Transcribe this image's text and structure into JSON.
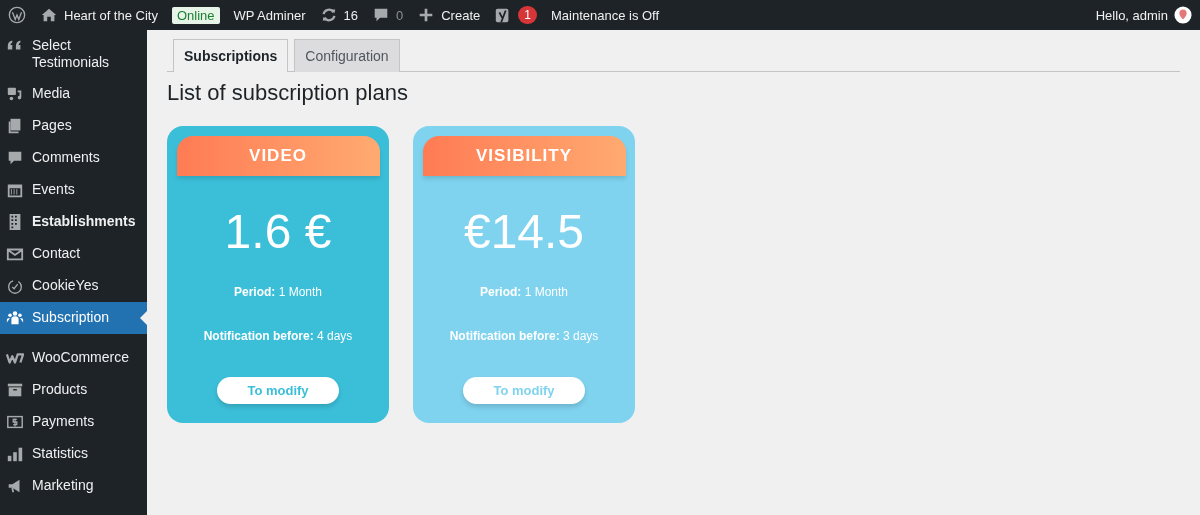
{
  "admin_bar": {
    "site_name": "Heart of the City",
    "status_badge": "Online",
    "adminer": "WP Adminer",
    "updates": "16",
    "comments": "0",
    "create": "Create",
    "seo_count": "1",
    "maintenance": "Maintenance is Off",
    "greeting": "Hello, admin"
  },
  "sidebar": {
    "items": [
      {
        "label": "Select Testimonials",
        "selected": false,
        "bold": false
      },
      {
        "label": "Media",
        "selected": false,
        "bold": false
      },
      {
        "label": "Pages",
        "selected": false,
        "bold": false
      },
      {
        "label": "Comments",
        "selected": false,
        "bold": false
      },
      {
        "label": "Events",
        "selected": false,
        "bold": false
      },
      {
        "label": "Establishments",
        "selected": false,
        "bold": true
      },
      {
        "label": "Contact",
        "selected": false,
        "bold": false
      },
      {
        "label": "CookieYes",
        "selected": false,
        "bold": false
      },
      {
        "label": "Subscription",
        "selected": true,
        "bold": false
      },
      {
        "label": "WooCommerce",
        "selected": false,
        "bold": false
      },
      {
        "label": "Products",
        "selected": false,
        "bold": false
      },
      {
        "label": "Payments",
        "selected": false,
        "bold": false
      },
      {
        "label": "Statistics",
        "selected": false,
        "bold": false
      },
      {
        "label": "Marketing",
        "selected": false,
        "bold": false
      }
    ]
  },
  "tabs": [
    {
      "label": "Subscriptions",
      "selected": true
    },
    {
      "label": "Configuration",
      "selected": false
    }
  ],
  "heading": "List of subscription plans",
  "plans": [
    {
      "name": "VIDEO",
      "price": "1.6 €",
      "period": "**Period:** 1 Month",
      "notification": "**Notification before:** 4 days",
      "button": "To modify",
      "color": "#3bbfd9"
    },
    {
      "name": "VISIBILITY",
      "price": "€14.5",
      "period": "**Period:** 1 Month",
      "notification": "**Notification before:** 3 days",
      "button": "To modify",
      "color": "#7fd3ef"
    }
  ]
}
